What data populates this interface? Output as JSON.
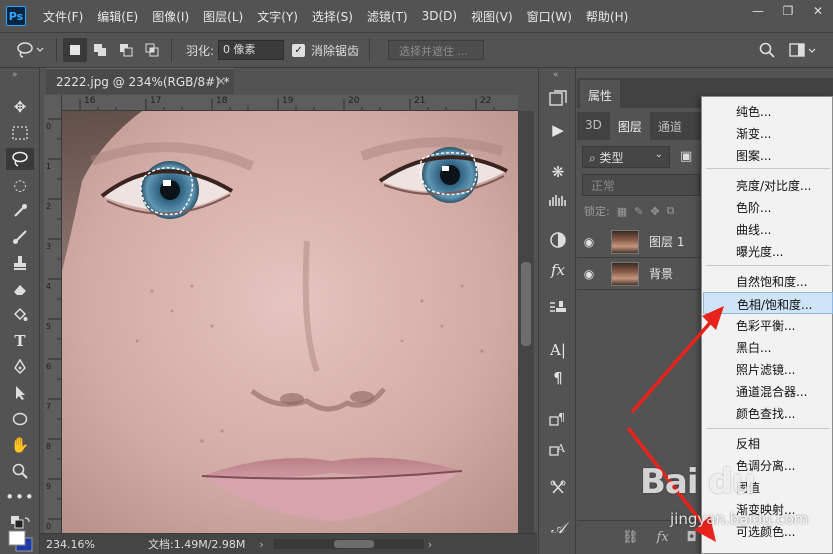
{
  "menubar": {
    "logo": "Ps",
    "items": [
      "文件(F)",
      "编辑(E)",
      "图像(I)",
      "图层(L)",
      "文字(Y)",
      "选择(S)",
      "滤镜(T)",
      "3D(D)",
      "视图(V)",
      "窗口(W)",
      "帮助(H)"
    ]
  },
  "options": {
    "feather_label": "羽化:",
    "feather_value": "0 像素",
    "antialias_label": "消除锯齿",
    "antialias_checked": true,
    "select_mask_label": "选择并遮住 ..."
  },
  "document": {
    "tab_title": "2222.jpg @ 234%(RGB/8#) *",
    "ruler_ticks": [
      "16",
      "17",
      "18",
      "19",
      "20",
      "21",
      "22"
    ],
    "ruler_left_ticks": [
      "0",
      "1",
      "2",
      "3",
      "4",
      "5",
      "6",
      "7",
      "8",
      "9",
      "0"
    ],
    "zoom": "234.16%",
    "doc_size": "文档:1.49M/2.98M"
  },
  "panels": {
    "properties_tab": "属性",
    "tabs": [
      "3D",
      "图层",
      "通道"
    ],
    "active_tab": "图层",
    "filter_label": "类型",
    "blend_mode": "正常",
    "lock_label": "锁定:",
    "layers": [
      {
        "name": "图层 1",
        "visible": true
      },
      {
        "name": "背景",
        "visible": true
      }
    ]
  },
  "adjust_menu": {
    "groups": [
      [
        "纯色...",
        "渐变...",
        "图案..."
      ],
      [
        "亮度/对比度...",
        "色阶...",
        "曲线...",
        "曝光度..."
      ],
      [
        "自然饱和度...",
        "色相/饱和度...",
        "色彩平衡...",
        "黑白...",
        "照片滤镜...",
        "通道混合器...",
        "颜色查找..."
      ],
      [
        "反相",
        "色调分离...",
        "阈值",
        "渐变映射...",
        "可选颜色..."
      ]
    ],
    "highlighted": "色相/饱和度..."
  },
  "watermark": {
    "main": "Bai du",
    "sub": "jingyan.baidu.com"
  },
  "colors": {
    "ui_bg": "#535353",
    "menu_bg": "#f2f2f2",
    "highlight": "#cfe4f7",
    "arrow": "#e8231c"
  }
}
